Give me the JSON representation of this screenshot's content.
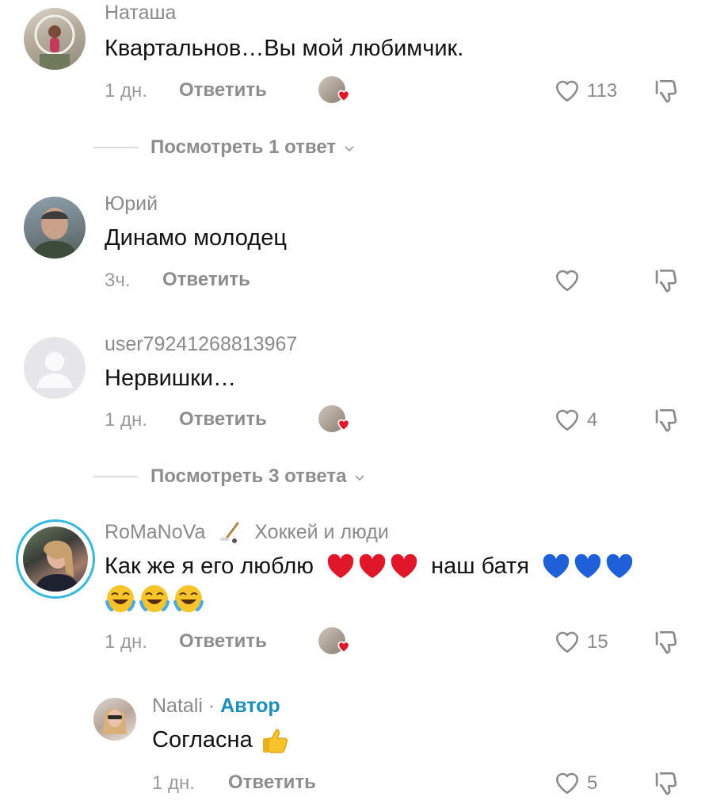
{
  "comments": [
    {
      "username": "Наташа",
      "text": "Квартальнов…Вы мой любимчик.",
      "time": "1 дн.",
      "reply_label": "Ответить",
      "likes": "113",
      "view_replies": "Посмотреть 1 ответ"
    },
    {
      "username": "Юрий",
      "text": "Динамо молодец",
      "time": "3ч.",
      "reply_label": "Ответить",
      "likes": ""
    },
    {
      "username": "user79241268813967",
      "text": "Нервишки…",
      "time": "1 дн.",
      "reply_label": "Ответить",
      "likes": "4",
      "view_replies": "Посмотреть 3 ответа"
    },
    {
      "username": "RoMaNoVa",
      "badge": "Хоккей и люди",
      "text_part1": "Как же я его люблю",
      "text_part2": "наш батя",
      "time": "1 дн.",
      "reply_label": "Ответить",
      "likes": "15"
    }
  ],
  "reply": {
    "username": "Natali",
    "separator": "·",
    "author_label": "Автор",
    "text": "Согласна",
    "time": "1 дн.",
    "reply_label": "Ответить",
    "likes": "5"
  },
  "colors": {
    "author_accent": "#1a8fb8",
    "heart_red": "#e0162b",
    "heart_blue": "#1f5fd8",
    "story_ring": "#35b8e0"
  }
}
